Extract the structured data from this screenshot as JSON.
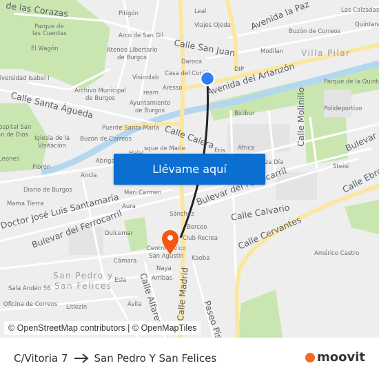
{
  "map": {
    "labels": [
      "de las Corazas",
      "Pitigón",
      "Parque de",
      "las Cuerdas",
      "El Wagón",
      "Arco de San Gil",
      "Ateneo Libertario",
      "de Burgos",
      "Calle San Juan",
      "Daroca",
      "Casa del Cordón",
      "Visionlab",
      "Aresso",
      "ream",
      "Ayuntamiento",
      "de Burgos",
      "Archivo Municipal",
      "de Burgos",
      "Universidad Isabel I",
      "Calle Santa Águeda",
      "Hospital San",
      "Juan de Dios",
      "Iglesia de la",
      "Visitación",
      "Puente Santa María",
      "Buzón de Correos",
      "Calle Calera",
      "Halal",
      "sque de Marie",
      "Abriga",
      "Florón",
      "Leones",
      "Leal",
      "Viajes Ojeda",
      "Avenida la Paz",
      "Las Calzadas",
      "Quintana",
      "Buzón de Correos",
      "Modilan",
      "Villa Pilar",
      "DIP",
      "Avenida del Arlanzón",
      "Parque de la Quintana",
      "Bicibur",
      "Calle Molinillo",
      "Polideportivo",
      "Bulevar de",
      "Eris",
      "Africa",
      "Plaza Día",
      "Steisi",
      "Ancla",
      "Diario de Burgos",
      "Mama Tierra",
      "Mari Carmen",
      "Aura",
      "Doctor José Luis Santamaría",
      "Bulevar del Ferrocarril",
      "Dulcemar",
      "Bulevar del Ferrocarril",
      "Calle Ebro",
      "Calle Calvario",
      "Calle Cervantes",
      "Sánchez",
      "Berceo",
      "Club Recrea",
      "Kaoba",
      "Centro Cívico",
      "San Agustín",
      "Cámara",
      "Naya",
      "Arribas",
      "San Pedro y",
      "San Felices",
      "Esla",
      "Sala Andén 56",
      "Calle Alfarero",
      "Calle Madrid",
      "Oficina de Correos",
      "Litlezin",
      "Ávila",
      "Paseo Pisones",
      "Américo Castro"
    ],
    "colors": {
      "route": "#222222",
      "origin": "#2f7ff5",
      "destination": "#f2570f",
      "major_road": "#fbe6a2",
      "park": "#c9e6b0",
      "water": "#b4d7f0",
      "button": "#0b6ed1"
    },
    "origin_icon": "blue-dot-icon",
    "destination_icon": "map-pin-icon"
  },
  "cta": {
    "label": "Llévame aquí"
  },
  "attribution": "© OpenStreetMap contributors | © OpenMapTiles",
  "footer": {
    "origin": "C/Vitoria 7",
    "destination": "San Pedro Y San Felices",
    "logo": "moovit",
    "arrow_icon": "arrow-right-icon"
  }
}
